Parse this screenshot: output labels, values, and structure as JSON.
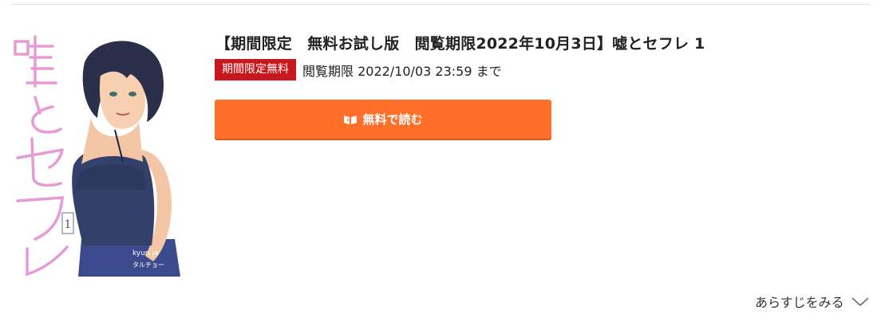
{
  "product": {
    "title": "【期間限定　無料お試し版　閲覧期限2022年10月3日】嘘とセフレ 1",
    "badge": "期間限定無料",
    "period": "閲覧期限 2022/10/03 23:59 まで",
    "read_button_label": "無料で読む",
    "read_button_icon": "open-book-icon",
    "synopsis_link": "あらすじをみる",
    "synopsis_icon": "chevron-down-icon"
  },
  "cover": {
    "title_text": "嘘とセフレ",
    "volume": "1",
    "credit_1": "kyun ja",
    "credit_2": "タルチョー"
  },
  "colors": {
    "badge_bg": "#c9171e",
    "button_bg": "#ff6f2a",
    "cover_title": "#e69ad6"
  }
}
